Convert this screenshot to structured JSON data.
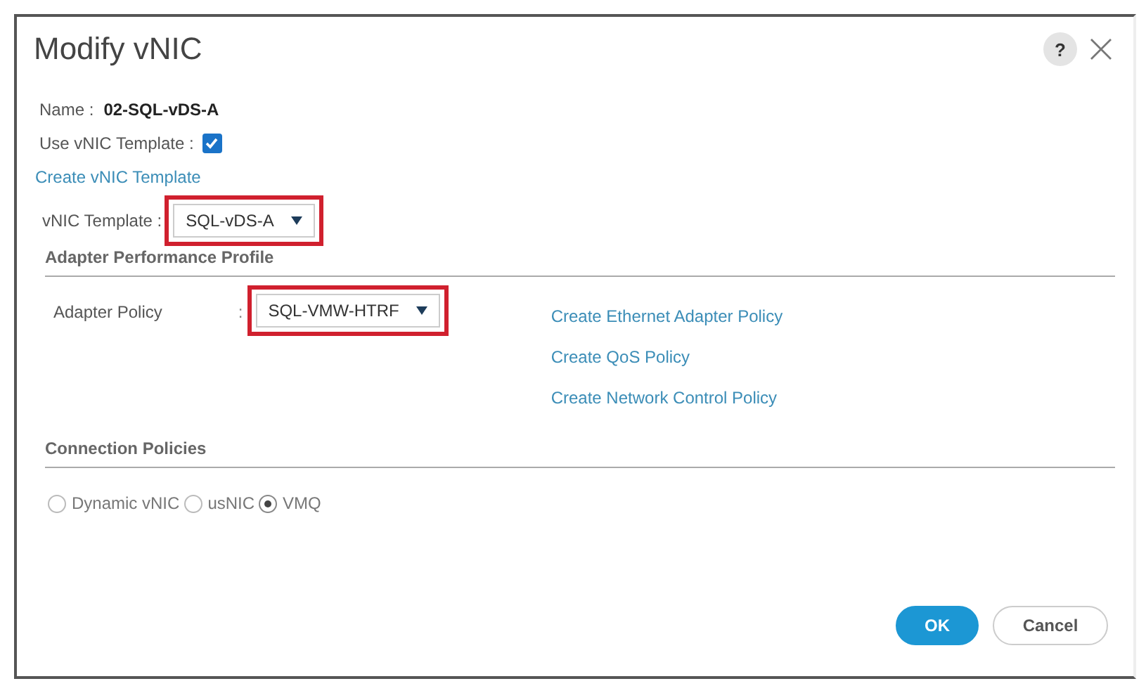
{
  "dialog": {
    "title": "Modify vNIC",
    "help": "?"
  },
  "name": {
    "label": "Name :",
    "value": "02-SQL-vDS-A"
  },
  "use_template": {
    "label": "Use vNIC Template :",
    "checked": true
  },
  "create_template_link": "Create vNIC Template",
  "vnic_template": {
    "label": "vNIC Template :",
    "value": "SQL-vDS-A",
    "highlighted": true
  },
  "adapter_section": {
    "title": "Adapter Performance Profile",
    "adapter_policy": {
      "label": "Adapter Policy",
      "separator": ":",
      "value": "SQL-VMW-HTRF",
      "highlighted": true
    },
    "links": [
      "Create Ethernet Adapter Policy",
      "Create QoS Policy",
      "Create Network Control Policy"
    ]
  },
  "connection_section": {
    "title": "Connection Policies",
    "options": [
      {
        "label": "Dynamic vNIC",
        "selected": false
      },
      {
        "label": "usNIC",
        "selected": false
      },
      {
        "label": "VMQ",
        "selected": true
      }
    ]
  },
  "buttons": [
    {
      "label": "OK",
      "kind": "primary"
    },
    {
      "label": "Cancel",
      "kind": "secondary"
    }
  ]
}
